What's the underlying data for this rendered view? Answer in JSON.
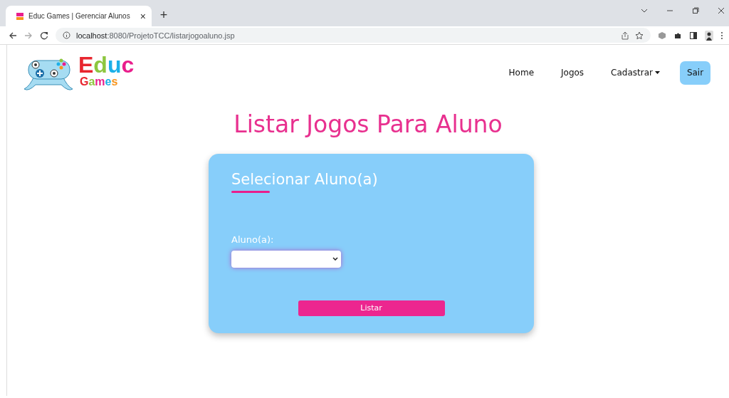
{
  "browser": {
    "tab": {
      "title": "Educ Games | Gerenciar Alunos",
      "close": "×"
    },
    "new_tab": "+",
    "url": {
      "host": "localhost",
      "rest": ":8080/ProjetoTCC/listarjogoaluno.jsp"
    }
  },
  "header": {
    "logo": {
      "title": "Educ",
      "subtitle": "Games"
    },
    "nav": [
      {
        "label": "Home",
        "kind": "link"
      },
      {
        "label": "Jogos",
        "kind": "link"
      },
      {
        "label": "Cadastrar",
        "kind": "dropdown"
      },
      {
        "label": "Sair",
        "kind": "button"
      }
    ]
  },
  "page_title": "Listar Jogos Para Aluno",
  "card": {
    "heading": "Selecionar Aluno(a)",
    "field_label": "Aluno(a):",
    "submit": "Listar"
  }
}
